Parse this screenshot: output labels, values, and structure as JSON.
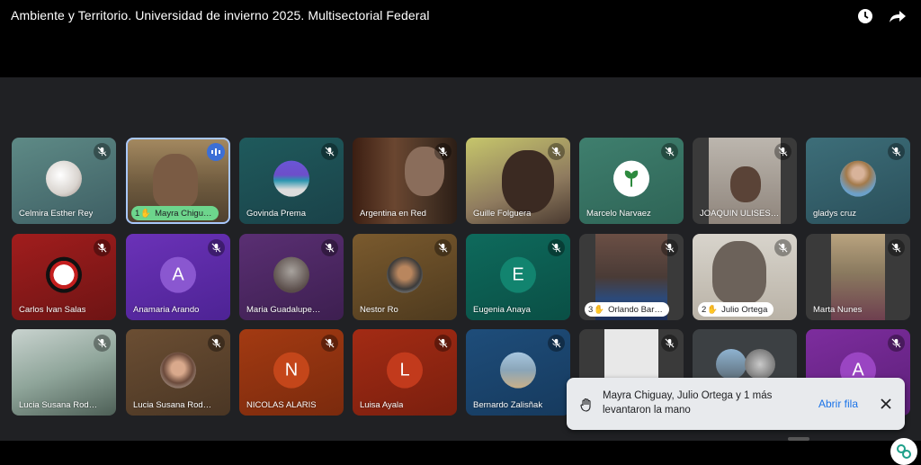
{
  "header": {
    "title": "Ambiente y Territorio. Universidad de invierno 2025. Multisectorial Federal"
  },
  "tiles": {
    "t1": {
      "name": "Celmira Esther Rey"
    },
    "t2": {
      "name": "Mayra Chigu…",
      "hand_num": "1"
    },
    "t3": {
      "name": "Govinda Prema"
    },
    "t4": {
      "name": "Argentina en Red"
    },
    "t5": {
      "name": "Guille Folguera"
    },
    "t6": {
      "name": "Marcelo Narvaez"
    },
    "t7": {
      "name": "JOAQUIN ULISES…"
    },
    "t8": {
      "name": "gladys cruz"
    },
    "t9": {
      "name": "Carlos Ivan Salas"
    },
    "t10": {
      "name": "Anamaria Arando",
      "letter": "A"
    },
    "t11": {
      "name": "Maria Guadalupe…"
    },
    "t12": {
      "name": "Nestor Ro"
    },
    "t13": {
      "name": "Eugenia Anaya",
      "letter": "E"
    },
    "t14": {
      "name": "Orlando Bar…",
      "hand_num": "3"
    },
    "t15": {
      "name": "Julio Ortega",
      "hand_num": "2"
    },
    "t16": {
      "name": "Marta Nunes"
    },
    "t17": {
      "name": "Lucia Susana Rod…"
    },
    "t18": {
      "name": "Lucia Susana Rod…"
    },
    "t19": {
      "name": "NICOLAS ALARIS",
      "letter": "N"
    },
    "t20": {
      "name": "Luisa Ayala",
      "letter": "L"
    },
    "t21": {
      "name": "Bernardo Zalisñak"
    },
    "t24": {
      "letter": "A"
    }
  },
  "toast": {
    "message": "Mayra Chiguay, Julio Ortega y 1 más levantaron la mano",
    "action": "Abrir fila"
  },
  "colors": {
    "stage": "#202124",
    "accent": "#a8c7fa",
    "hand_green": "#6dd58c",
    "link": "#1a73e8"
  }
}
